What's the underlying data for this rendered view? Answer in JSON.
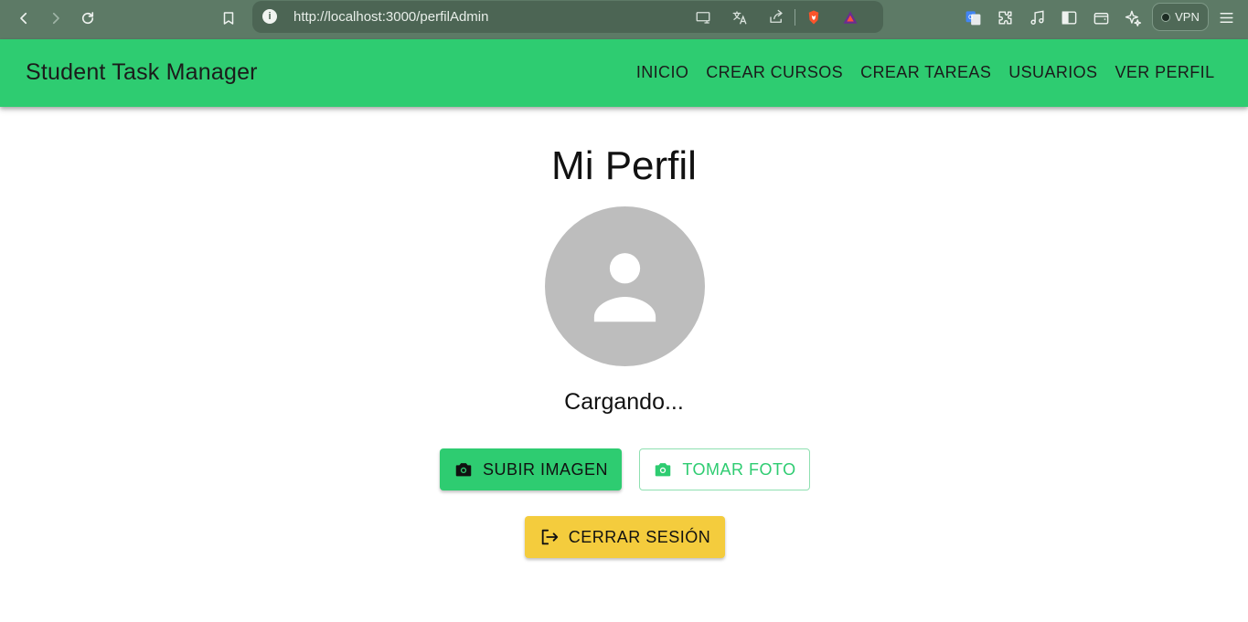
{
  "browser": {
    "url": "http://localhost:3000/perfilAdmin",
    "info_glyph": "i",
    "vpn_label": "VPN",
    "icons": [
      "back-icon",
      "forward-icon",
      "reload-icon",
      "bookmark-icon",
      "info-icon",
      "cast-icon",
      "translate-icon",
      "share-icon",
      "brave-shields-icon",
      "brave-rewards-icon",
      "google-translate-icon",
      "extensions-icon",
      "music-icon",
      "sidebar-icon",
      "wallet-icon",
      "leo-ai-icon",
      "vpn-icon",
      "menu-icon"
    ]
  },
  "appbar": {
    "brand": "Student Task Manager",
    "links": [
      "INICIO",
      "CREAR CURSOS",
      "CREAR TAREAS",
      "USUARIOS",
      "VER PERFIL"
    ],
    "color": "#2ecc71"
  },
  "profile": {
    "title": "Mi Perfil",
    "status": "Cargando...",
    "avatar_icon": "person-icon",
    "avatar_color": "#bdbdbd"
  },
  "actions": {
    "upload_label": "SUBIR IMAGEN",
    "upload_icon": "camera-icon",
    "photo_label": "TOMAR FOTO",
    "photo_icon": "camera-icon",
    "logout_label": "CERRAR SESIÓN",
    "logout_icon": "logout-icon",
    "logout_color": "#f4cc3d"
  }
}
